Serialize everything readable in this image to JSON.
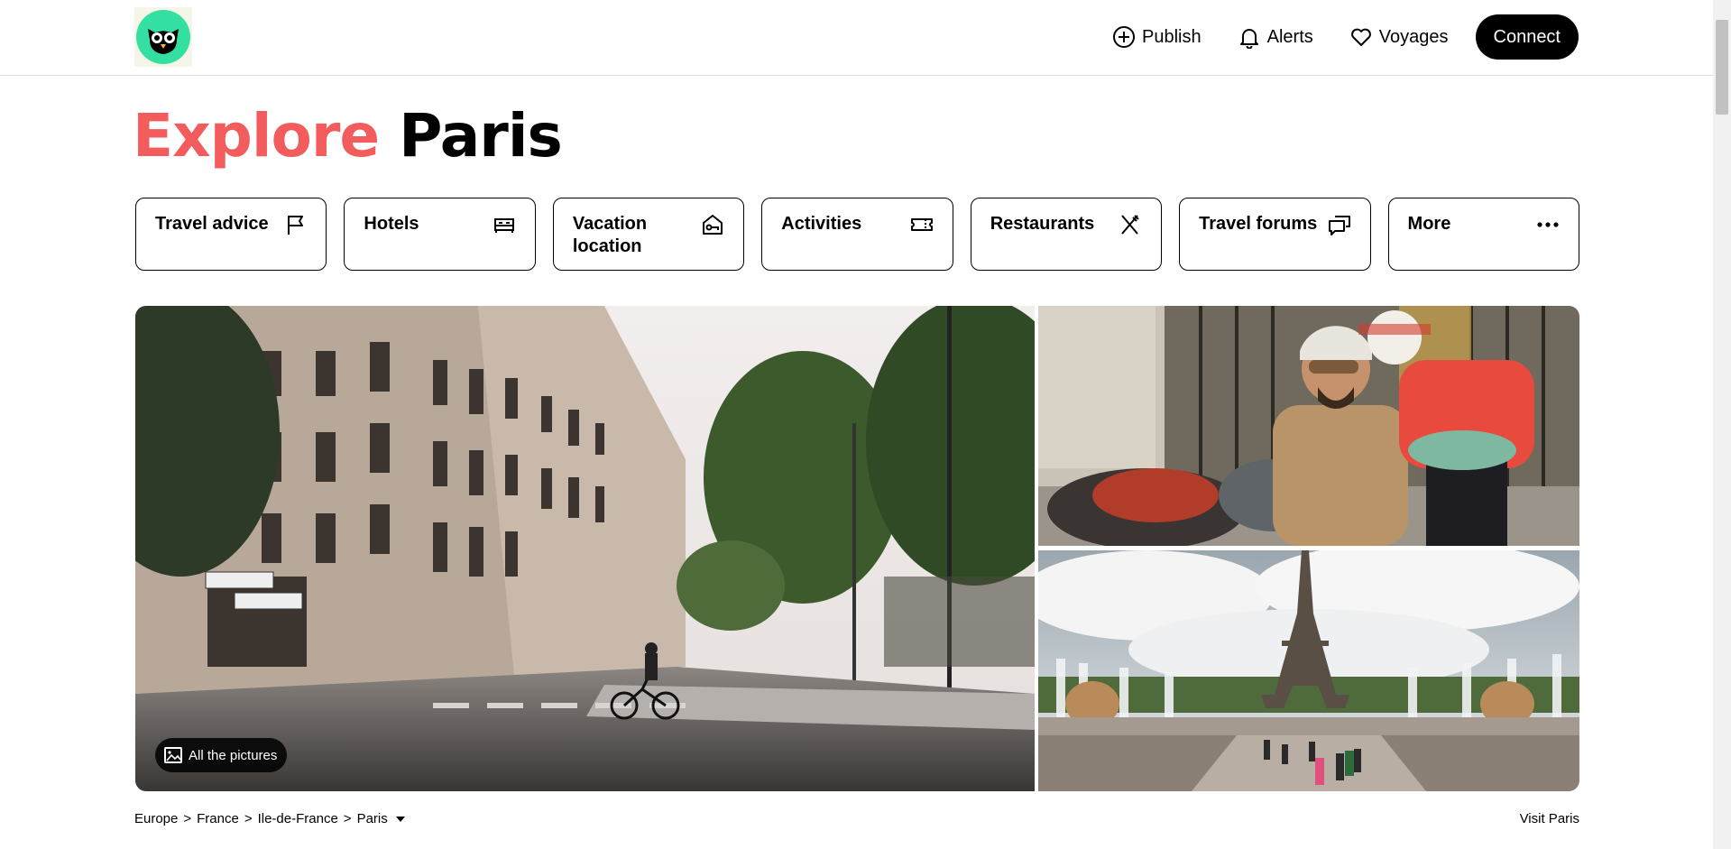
{
  "header": {
    "nav": [
      {
        "label": "Publish",
        "icon": "plus-circle-icon"
      },
      {
        "label": "Alerts",
        "icon": "bell-icon"
      },
      {
        "label": "Voyages",
        "icon": "heart-icon"
      }
    ],
    "connect_label": "Connect",
    "logo_icon": "owl-logo-icon",
    "brand_color": "#34e0a1"
  },
  "title": {
    "accent": "Explore",
    "city": "Paris",
    "accent_color": "#f25c5c"
  },
  "categories": [
    {
      "label": "Travel advice",
      "icon": "flag-icon"
    },
    {
      "label": "Hotels",
      "icon": "bed-icon"
    },
    {
      "label": "Vacation location",
      "icon": "house-key-icon"
    },
    {
      "label": "Activities",
      "icon": "ticket-icon"
    },
    {
      "label": "Restaurants",
      "icon": "fork-knife-icon"
    },
    {
      "label": "Travel forums",
      "icon": "chat-bubbles-icon"
    },
    {
      "label": "More",
      "icon": "more-dots-icon"
    }
  ],
  "gallery": {
    "all_pictures_label": "All the pictures",
    "images": [
      {
        "name": "paris-street-cyclist-photo"
      },
      {
        "name": "sidecar-couple-photo"
      },
      {
        "name": "eiffel-tower-fountains-photo"
      }
    ]
  },
  "breadcrumb": {
    "items": [
      "Europe",
      "France",
      "Ile-de-France",
      "Paris"
    ],
    "separator": ">"
  },
  "visit_link": "Visit Paris"
}
